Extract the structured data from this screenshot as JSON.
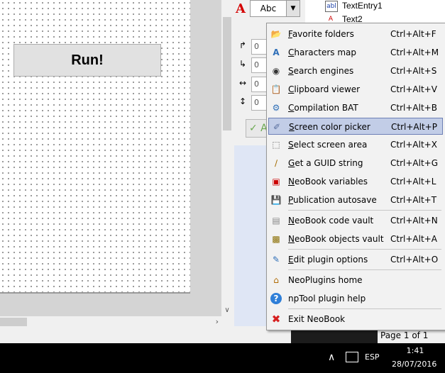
{
  "canvas": {
    "run_button": "Run!"
  },
  "font_toolbar": {
    "sample_glyph": "A",
    "font_combo_value": "Abc"
  },
  "tree": {
    "items": [
      {
        "icon": "abl",
        "label": "TextEntry1"
      },
      {
        "icon": "A",
        "label": "Text2"
      }
    ]
  },
  "properties": {
    "left_value": "0",
    "top_value": "0",
    "width_value": "0",
    "height_value": "0",
    "apply_glyph": "✓ A"
  },
  "status": {
    "page": "Page 1 of 1"
  },
  "menu": {
    "items": [
      {
        "label": "Favorite folders",
        "shortcut": "Ctrl+Alt+F",
        "icon": "folder-icon",
        "mn": "F",
        "rest": "avorite folders"
      },
      {
        "label": "Characters map",
        "shortcut": "Ctrl+Alt+M",
        "icon": "characters-map-icon",
        "mn": "C",
        "rest": "haracters map"
      },
      {
        "label": "Search engines",
        "shortcut": "Ctrl+Alt+S",
        "icon": "binoculars-icon",
        "mn": "S",
        "rest": "earch engines"
      },
      {
        "label": "Clipboard viewer",
        "shortcut": "Ctrl+Alt+V",
        "icon": "clipboard-icon",
        "mn": "C",
        "rest": "lipboard viewer"
      },
      {
        "label": "Compilation BAT",
        "shortcut": "Ctrl+Alt+B",
        "icon": "compile-icon",
        "mn": "C",
        "rest": "ompilation BAT"
      },
      {
        "label": "Screen color picker",
        "shortcut": "Ctrl+Alt+P",
        "icon": "eyedropper-icon",
        "mn": "S",
        "rest": "creen color picker",
        "highlighted": true
      },
      {
        "label": "Select screen area",
        "shortcut": "Ctrl+Alt+X",
        "icon": "select-area-icon",
        "mn": "S",
        "rest": "elect screen area"
      },
      {
        "label": "Get a GUID string",
        "shortcut": "Ctrl+Alt+G",
        "icon": "wand-icon",
        "mn": "G",
        "rest": "et a GUID string"
      },
      {
        "label": "NeoBook variables",
        "shortcut": "Ctrl+Alt+L",
        "icon": "variables-icon",
        "mn": "N",
        "rest": "eoBook variables"
      },
      {
        "label": "Publication autosave",
        "shortcut": "Ctrl+Alt+T",
        "icon": "save-icon",
        "mn": "P",
        "rest": "ublication autosave"
      },
      {
        "label": "NeoBook code vault",
        "shortcut": "Ctrl+Alt+N",
        "icon": "code-vault-icon",
        "mn": "N",
        "rest": "eoBook code vault"
      },
      {
        "label": "NeoBook objects vault",
        "shortcut": "Ctrl+Alt+A",
        "icon": "objects-vault-icon",
        "mn": "N",
        "rest": "eoBook objects vault"
      },
      {
        "label": "Edit plugin options",
        "shortcut": "Ctrl+Alt+O",
        "icon": "edit-options-icon",
        "mn": "E",
        "rest": "dit plugin options"
      },
      {
        "label": "NeoPlugins home",
        "shortcut": "",
        "icon": "home-icon",
        "mn": "",
        "rest": "NeoPlugins home"
      },
      {
        "label": "npTool plugin help",
        "shortcut": "",
        "icon": "help-icon",
        "mn": "",
        "rest": "npTool plugin help"
      },
      {
        "label": "Exit NeoBook",
        "shortcut": "",
        "icon": "exit-icon",
        "mn": "",
        "rest": "Exit NeoBook"
      }
    ]
  },
  "taskbar": {
    "language": "ESP",
    "time": "1:41",
    "date": "28/07/2016"
  },
  "colors": {
    "menu_highlight": "#c2cde7",
    "accent_red": "#d40000"
  }
}
